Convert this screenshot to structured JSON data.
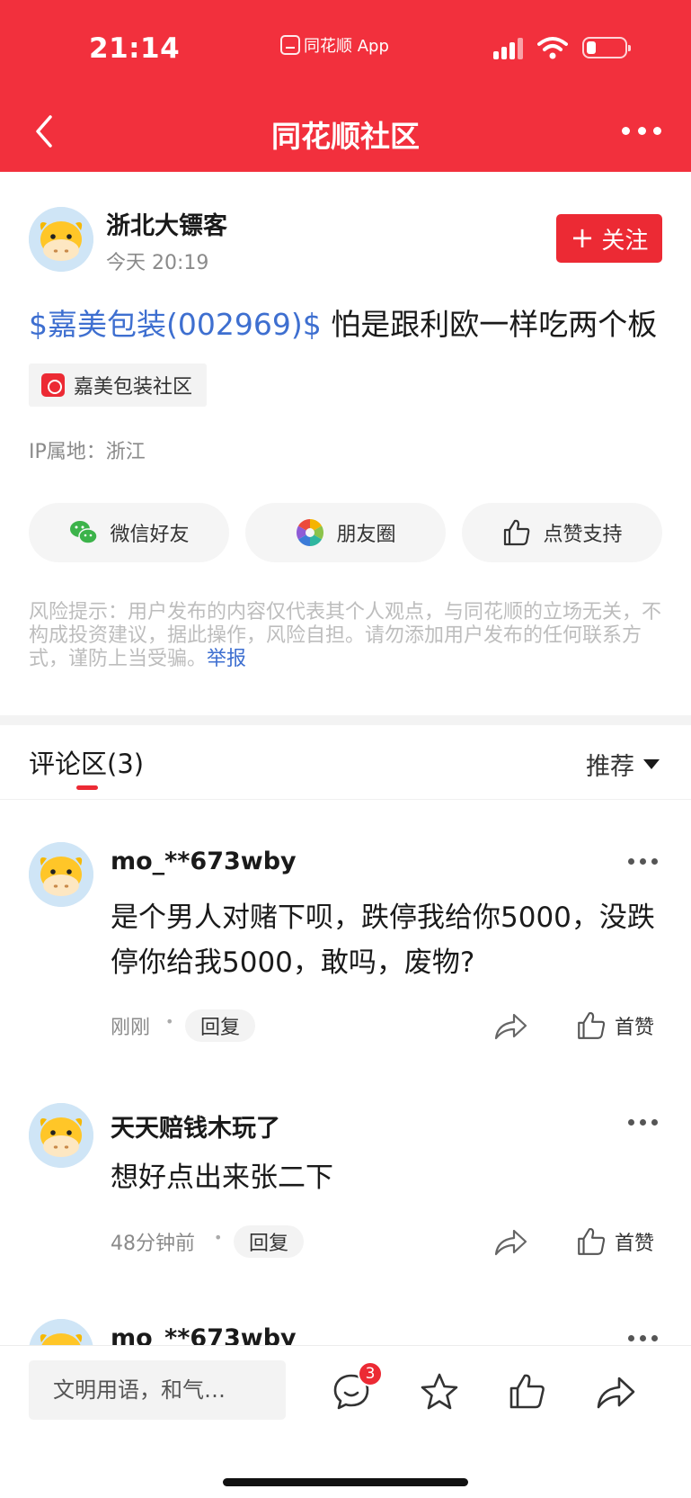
{
  "status_bar": {
    "time": "21:14",
    "app_label": "同花顺 App",
    "icons": [
      "signal-icon",
      "wifi-icon",
      "battery-icon"
    ]
  },
  "nav": {
    "title": "同花顺社区",
    "icons": [
      "back-arrow-icon",
      "more-dots-icon"
    ]
  },
  "post": {
    "author": "浙北大镖客",
    "time": "今天 20:19",
    "follow_label": "关注",
    "stock_link": "$嘉美包装(002969)$",
    "text": " 怕是跟利欧一样吃两个板",
    "community_tag": "嘉美包装社区",
    "ip_location": "IP属地：浙江",
    "share": {
      "wechat": "微信好友",
      "moments": "朋友圈",
      "like_support": "点赞支持"
    },
    "risk_tip": "风险提示：用户发布的内容仅代表其个人观点，与同花顺的立场无关，不构成投资建议，据此操作，风险自担。请勿添加用户发布的任何联系方式，谨防上当受骗。",
    "report_label": "举报"
  },
  "comments_section": {
    "title": "评论区(3)",
    "sort_label": "推荐",
    "items": [
      {
        "name": "mo_**673wby",
        "text": "是个男人对赌下呗，跌停我给你5000，没跌停你给我5000，敢吗，废物?",
        "time": "刚刚",
        "reply_label": "回复",
        "like_label": "首赞"
      },
      {
        "name": "天天赔钱木玩了",
        "text": "想好点出来张二下",
        "time": "48分钟前",
        "reply_label": "回复",
        "like_label": "首赞"
      },
      {
        "name": "mo_**673wby"
      }
    ]
  },
  "bottom_bar": {
    "input_placeholder": "文明用语，和气…",
    "comment_count_badge": "3",
    "icons": [
      "comment-icon",
      "star-icon",
      "thumbs-up-icon",
      "share-icon"
    ]
  },
  "colors": {
    "brand_red": "#f2303d",
    "link_blue": "#3e6fd0"
  }
}
